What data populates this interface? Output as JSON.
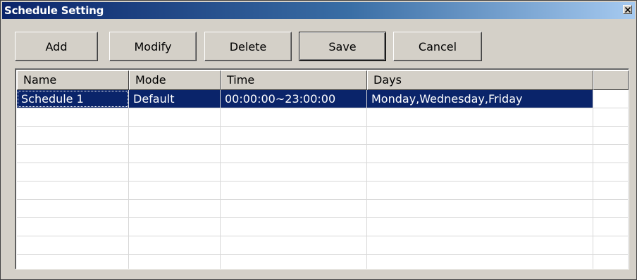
{
  "window": {
    "title": "Schedule Setting"
  },
  "toolbar": {
    "add_label": "Add",
    "modify_label": "Modify",
    "delete_label": "Delete",
    "save_label": "Save",
    "cancel_label": "Cancel"
  },
  "table": {
    "columns": [
      "Name",
      "Mode",
      "Time",
      "Days",
      ""
    ],
    "rows": [
      [
        "Schedule 1",
        "Default",
        "00:00:00~23:00:00",
        "Monday,Wednesday,Friday"
      ],
      [
        "",
        "",
        "",
        ""
      ],
      [
        "",
        "",
        "",
        ""
      ],
      [
        "",
        "",
        "",
        ""
      ],
      [
        "",
        "",
        "",
        ""
      ],
      [
        "",
        "",
        "",
        ""
      ],
      [
        "",
        "",
        "",
        ""
      ],
      [
        "",
        "",
        "",
        ""
      ],
      [
        "",
        "",
        "",
        ""
      ],
      [
        "",
        "",
        "",
        ""
      ]
    ],
    "selected_row": 0
  },
  "icons": {
    "close": "close-icon"
  },
  "colors": {
    "title_bar_start": "#0a246a",
    "title_bar_end": "#a6caf0",
    "selection": "#0a246a",
    "face": "#d4d0c8"
  }
}
